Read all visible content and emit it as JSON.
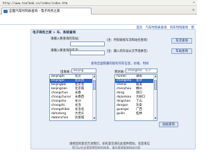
{
  "browser": {
    "url": "http://www.toolbak.cn/index/index.htm",
    "tab_title": "全国汽车时刻表查询 - 电子商务之家",
    "close_glyph": "×",
    "chevron_glyph": "»"
  },
  "top_links": [
    "首页",
    "汽车时刻表查询",
    "列车时刻查询",
    "帮"
  ],
  "section": {
    "title": "电子商务之家 > 车、系统查询"
  },
  "form": {
    "departure_label": "请输入要查询的车站：",
    "departure_hint": "（注：时刻表按车次和站名查询）",
    "departure_button": "车次查询",
    "arrival_label": "请输入要查询的车次：",
    "arrival_hint": "（注：输入的车站以汉字或拼音）",
    "arrival_button": "车站查询"
  },
  "notice": "查询全国铁路的现有列车信息，价格、时间",
  "from_list": {
    "label": "出发站：",
    "filter": "beijing",
    "items": [
      {
        "en": "beijingxi",
        "zh": "北京西"
      },
      {
        "en": "beijingbei",
        "zh": "北京北"
      },
      {
        "en": "beijingnan",
        "zh": "北京南"
      },
      {
        "en": "changchun",
        "zh": "长春"
      },
      {
        "en": "changchunxi",
        "zh": "长春西"
      },
      {
        "en": "changsha",
        "zh": "长沙"
      },
      {
        "en": "changzhi",
        "zh": "长治"
      },
      {
        "en": "changzhibei",
        "zh": "长治北"
      },
      {
        "en": "dahutong",
        "zh": "大虎头"
      },
      {
        "en": "dabanchen",
        "zh": "达坂城"
      }
    ],
    "header": {
      "en": "beijingdi",
      "zh": "北京"
    },
    "selected_index": 1
  },
  "to_list": {
    "label": "到达站：",
    "filter": "changsha",
    "filter_tail": "长沙",
    "items": [
      {
        "en": "hunan",
        "zh": "湖南"
      },
      {
        "en": "changsha",
        "zh": "长沙"
      },
      {
        "en": "chenxi",
        "zh": "辰溪"
      },
      {
        "en": "chenzhou",
        "zh": "郴州"
      },
      {
        "en": "dong",
        "zh": "洞口"
      },
      {
        "en": "dajiankou",
        "zh": "大峡口"
      },
      {
        "en": "dingshan",
        "zh": "丁山"
      },
      {
        "en": "dongan",
        "zh": "东安"
      },
      {
        "en": "guangxi",
        "zh": "广西"
      },
      {
        "en": "guilin",
        "zh": "桂林"
      }
    ],
    "selected_index": 1
  },
  "query_button": "站站查询",
  "footer": {
    "line1": "请把您的意见告诉我们，如有意见请在此提供帮助，欢迎来信",
    "line2": "您可以在这里获得您的时刻表，请勿直接复制网站内容"
  },
  "colors": {
    "panel_bg": "#e8eef7",
    "selection": "#316ac5",
    "link": "#0b3a8c"
  }
}
